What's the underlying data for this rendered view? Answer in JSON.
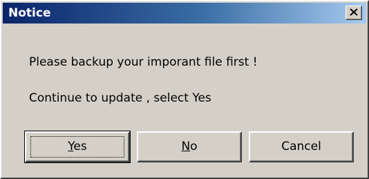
{
  "dialog": {
    "title": "Notice",
    "message_line1": "Please backup your imporant file first !",
    "message_line2": "Continue to update , select Yes"
  },
  "buttons": {
    "yes": {
      "accel": "Y",
      "rest": "es"
    },
    "no": {
      "accel": "N",
      "rest": "o"
    },
    "cancel": "Cancel"
  },
  "icons": {
    "close": "close-icon"
  }
}
